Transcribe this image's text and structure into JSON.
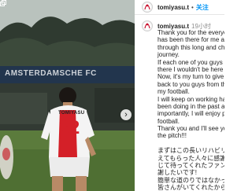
{
  "post": {
    "username": "tomiyasu.t",
    "follow_label": "关注",
    "time": "19小时",
    "caption_lines": [
      "Thank you for the everyo",
      "has been there for me and su",
      "through this long and ch",
      "journey.",
      "If each one of you guys w",
      "there I wouldn't be here",
      "Now, it's my turn to give",
      "back to you guys from th",
      "my football.",
      "I will keep on working ha",
      "been doing in the past ar",
      "importantly, I will enjoy p",
      "football.",
      "Thank you and I'll see yo",
      "the pitch!!!",
      "",
      "まずはこの長いリハビリ",
      "えてもらった人々に感謝",
      "じて待ってくれたファン",
      "謝したいです!",
      "簡単な道のりではなかっ",
      "皆さんがいてくれたから"
    ]
  },
  "photo": {
    "banner_text": "AMSTERDAMSCHE FC",
    "jersey_name": "TOMIYASU",
    "jersey_number": "32"
  },
  "icons": {
    "avatar": "ajax-logo-icon",
    "next": "chevron-right-icon",
    "carousel_badge": "carousel-icon"
  },
  "colors": {
    "follow": "#0095f6",
    "jersey_red": "#d42028"
  }
}
